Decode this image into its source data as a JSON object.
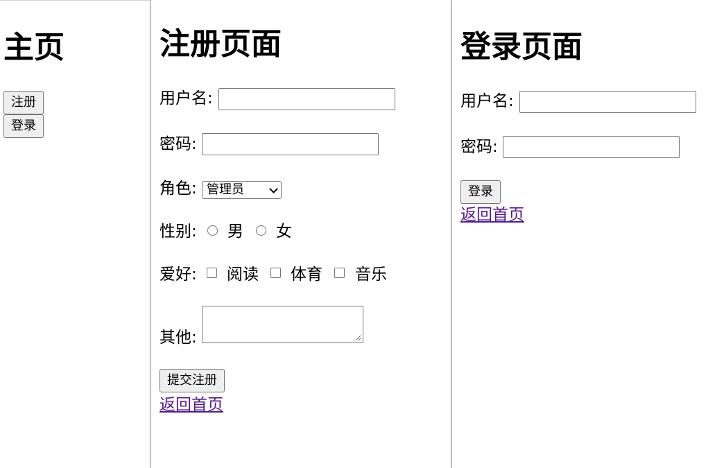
{
  "home": {
    "title": "主页",
    "register_button": "注册",
    "login_button": "登录"
  },
  "register": {
    "title": "注册页面",
    "username_label": "用户名:",
    "password_label": "密码:",
    "role_label": "角色:",
    "role_selected": "管理员",
    "gender_label": "性别:",
    "gender_options": [
      "男",
      "女"
    ],
    "hobby_label": "爱好:",
    "hobby_options": [
      "阅读",
      "体育",
      "音乐"
    ],
    "other_label": "其他:",
    "submit_button": "提交注册",
    "back_link": "返回首页"
  },
  "login": {
    "title": "登录页面",
    "username_label": "用户名:",
    "password_label": "密码:",
    "login_button": "登录",
    "back_link": "返回首页"
  },
  "colors": {
    "visited_link": "#551a8b",
    "button_bg": "#efefef",
    "control_border": "#767676"
  }
}
